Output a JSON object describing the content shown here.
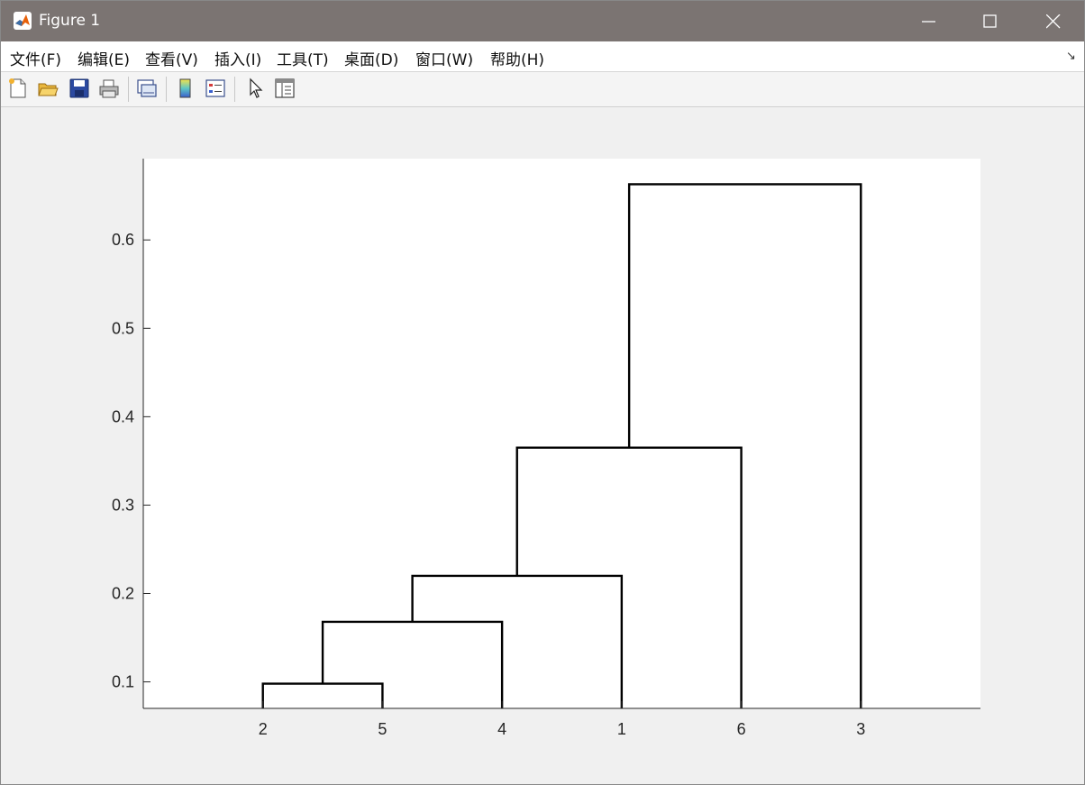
{
  "window": {
    "title": "Figure 1"
  },
  "menu": {
    "items": [
      "文件(F)",
      "编辑(E)",
      "查看(V)",
      "插入(I)",
      "工具(T)",
      "桌面(D)",
      "窗口(W)",
      "帮助(H)"
    ],
    "dock_arrow": "↘"
  },
  "toolbar": {
    "icons": [
      "new-figure-icon",
      "open-file-icon",
      "save-icon",
      "print-icon",
      "link-plot-icon",
      "colorbar-icon",
      "legend-icon",
      "pointer-icon",
      "property-inspector-icon"
    ]
  },
  "chart_data": {
    "type": "dendrogram",
    "title": "",
    "xlabel": "",
    "ylabel": "",
    "leaf_order": [
      "2",
      "5",
      "4",
      "1",
      "6",
      "3"
    ],
    "ylim": [
      0.07,
      0.692
    ],
    "yticks": [
      0.1,
      0.2,
      0.3,
      0.4,
      0.5,
      0.6
    ],
    "ytick_labels": [
      "0.1",
      "0.2",
      "0.3",
      "0.4",
      "0.5",
      "0.6"
    ],
    "links": [
      {
        "left": "2",
        "right": "5",
        "height": 0.098
      },
      {
        "left": "2-5",
        "right": "4",
        "height": 0.168
      },
      {
        "left": "2-5-4",
        "right": "1",
        "height": 0.22
      },
      {
        "left": "2-5-4-1",
        "right": "6",
        "height": 0.365
      },
      {
        "left": "2-5-4-1-6",
        "right": "3",
        "height": 0.663
      }
    ],
    "line_color": "#000000",
    "grid": false
  }
}
